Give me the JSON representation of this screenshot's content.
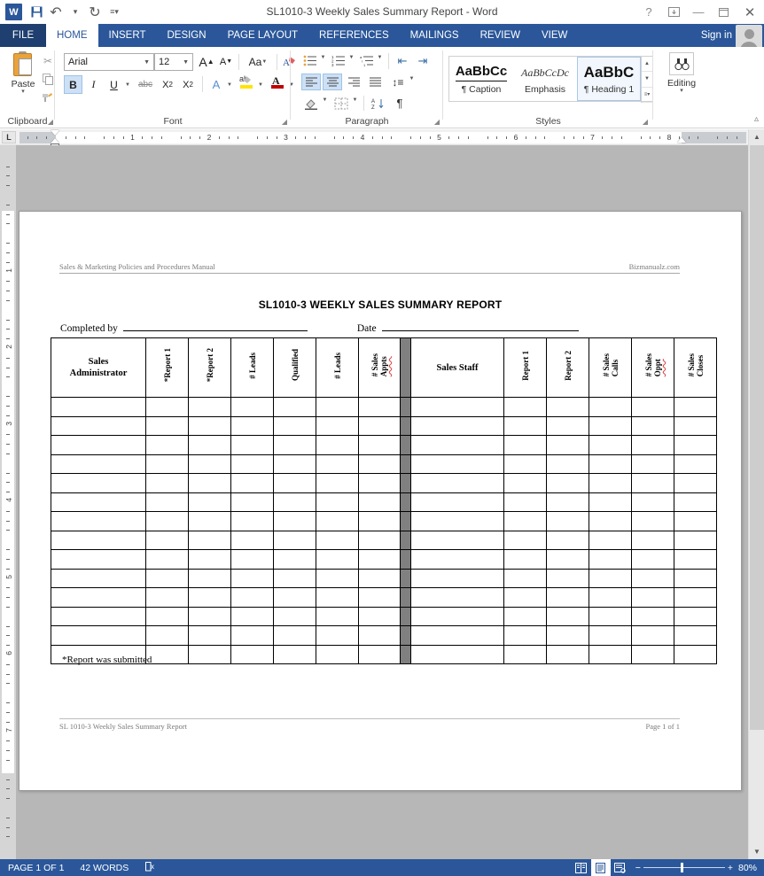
{
  "window": {
    "title": "SL1010-3 Weekly Sales Summary Report - Word",
    "app_logo": "W",
    "quick_access": [
      {
        "name": "save",
        "glyph": "ὋE"
      },
      {
        "name": "undo",
        "glyph": "↶"
      },
      {
        "name": "redo",
        "glyph": "↻"
      },
      {
        "name": "customize",
        "glyph": "≡"
      }
    ],
    "controls": {
      "help": "?",
      "ribbon_display": "⤓",
      "minimize": "–",
      "maximize": "☐",
      "close": "✕"
    }
  },
  "tabs": {
    "file": "FILE",
    "items": [
      {
        "label": "HOME",
        "active": true
      },
      {
        "label": "INSERT",
        "active": false
      },
      {
        "label": "DESIGN",
        "active": false
      },
      {
        "label": "PAGE LAYOUT",
        "active": false
      },
      {
        "label": "REFERENCES",
        "active": false
      },
      {
        "label": "MAILINGS",
        "active": false
      },
      {
        "label": "REVIEW",
        "active": false
      },
      {
        "label": "VIEW",
        "active": false
      }
    ],
    "sign_in": "Sign in"
  },
  "ribbon": {
    "groups": [
      {
        "name": "clipboard",
        "label": "Clipboard"
      },
      {
        "name": "font",
        "label": "Font"
      },
      {
        "name": "paragraph",
        "label": "Paragraph"
      },
      {
        "name": "styles",
        "label": "Styles"
      },
      {
        "name": "editing",
        "label": "Editing"
      }
    ],
    "clipboard": {
      "paste_label": "Paste",
      "cut": "✂",
      "copy": "⧉",
      "format_painter": "὘C"
    },
    "font": {
      "font_name": "Arial",
      "font_size": "12",
      "grow_font": "A",
      "shrink_font": "A",
      "change_case": "Aa",
      "clear_formatting": "὘D",
      "bold": "B",
      "italic": "I",
      "underline": "U",
      "strikethrough": "abc",
      "subscript": "X₂",
      "superscript": "X²",
      "text_effects": "A",
      "highlight": "ab",
      "font_color": "A"
    },
    "paragraph": {
      "bullets": "≡",
      "numbering": "≡",
      "multilevel": "≡",
      "decrease_indent": "⇤",
      "increase_indent": "⇥",
      "sort": "A↓",
      "show_marks": "¶",
      "align_left": "≡",
      "align_center": "≡",
      "align_right": "≡",
      "justify": "≡",
      "line_spacing": "↕",
      "shading": "■",
      "borders": "⊞"
    },
    "styles": {
      "items": [
        {
          "preview": "AaBbCc",
          "name": "¶ Caption",
          "selected": false
        },
        {
          "preview": "AaBbCcDc",
          "name": "Emphasis",
          "selected": false
        },
        {
          "preview": "AaBbC",
          "name": "¶ Heading 1",
          "selected": true
        }
      ],
      "scroll_up": "▲",
      "scroll_down": "▼",
      "more": "▾"
    },
    "editing": {
      "label": "Editing",
      "icon": "ὐD",
      "arrow": "▾"
    },
    "collapse": "^"
  },
  "rulers": {
    "tab_selector": "L",
    "horizontal_numbers": [
      "1",
      "2",
      "3",
      "4",
      "5",
      "6",
      "7",
      "8"
    ],
    "vertical_numbers": [
      "1",
      "2",
      "3",
      "4",
      "5",
      "6",
      "7"
    ]
  },
  "document": {
    "header_left": "Sales & Marketing Policies and Procedures Manual",
    "header_right": "Bizmanualz.com",
    "title": "SL1010-3 WEEKLY SALES SUMMARY REPORT",
    "completed_by_label": "Completed by",
    "date_label": "Date",
    "note": "*Report was submitted",
    "footer_left": "SL 1010-3 Weekly Sales Summary Report",
    "footer_right": "Page 1 of 1",
    "table": {
      "left_group_header": "Sales\nAdministrator",
      "left_group_header_line1": "Sales",
      "left_group_header_line2": "Administrator",
      "right_group_header": "Sales Staff",
      "left_columns": [
        {
          "text": "*Report 1",
          "misspelled": false
        },
        {
          "text": "*Report 2",
          "misspelled": false
        },
        {
          "text": "# Leads",
          "misspelled": false
        },
        {
          "text": "Qualified",
          "misspelled": false
        },
        {
          "text": "# Leads",
          "misspelled": false
        },
        {
          "text": "# Sales",
          "sub": "Appts",
          "misspelled": true
        }
      ],
      "right_columns": [
        {
          "text": "Report 1",
          "misspelled": false
        },
        {
          "text": "Report 2",
          "misspelled": false
        },
        {
          "text": "# Sales",
          "sub": "Calls",
          "misspelled": false
        },
        {
          "text": "# Sales",
          "sub": "Oppt",
          "misspelled": true
        },
        {
          "text": "# Sales",
          "sub": "Closes",
          "misspelled": false
        }
      ],
      "body_row_count": 14,
      "divider_color": "#808080"
    }
  },
  "status_bar": {
    "page": "PAGE 1 OF 1",
    "words": "42 WORDS",
    "proofing_icon": "Ὅ6",
    "views": [
      {
        "name": "read-mode",
        "glyph": "Ὅ6",
        "active": false
      },
      {
        "name": "print-layout",
        "glyph": "὜B",
        "active": true
      },
      {
        "name": "web-layout",
        "glyph": "Ὕ2",
        "active": false
      }
    ],
    "zoom_out": "−",
    "zoom_in": "+",
    "zoom_level": "80%"
  },
  "colors": {
    "accent": "#2b579a",
    "file_tab": "#1e3f6f",
    "divider_gray": "#808080",
    "spell_red": "#d83b3b",
    "page_bg": "#b7b7b7"
  }
}
